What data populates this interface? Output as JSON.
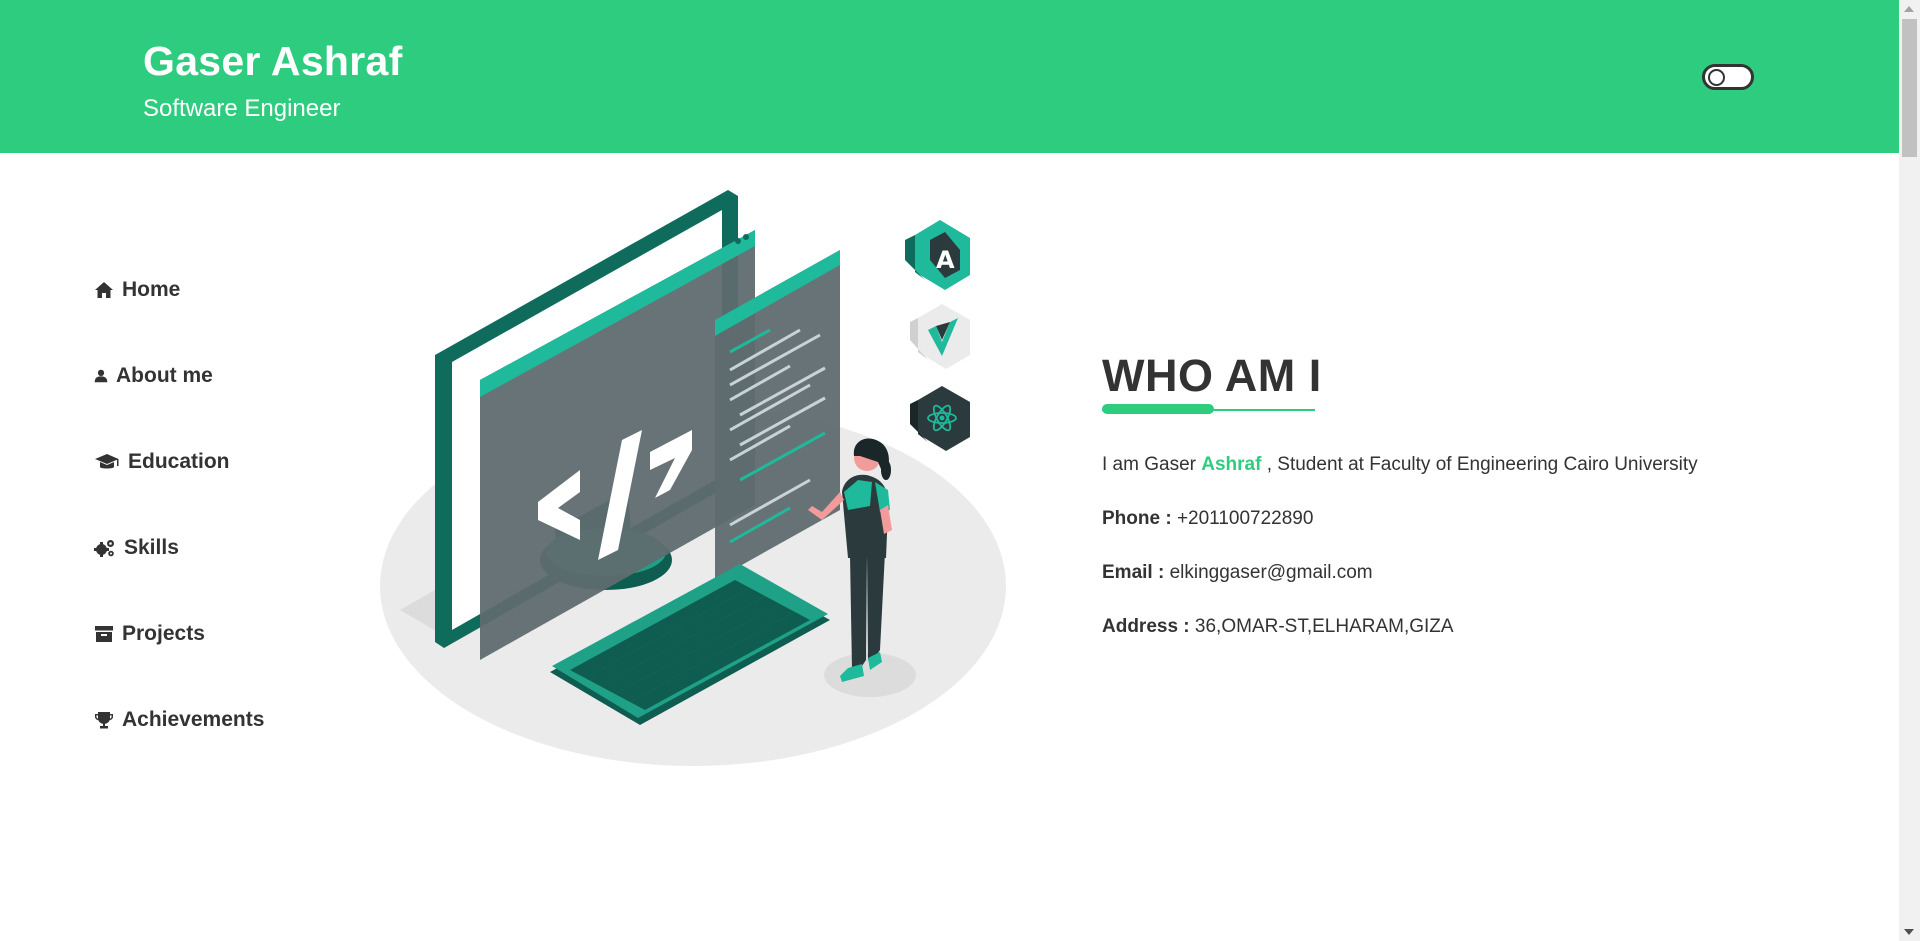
{
  "theme": {
    "accent": "#2ecc7f",
    "text": "#333333"
  },
  "header": {
    "name": "Gaser Ashraf",
    "role": "Software Engineer",
    "theme_toggle": {
      "state": "off"
    }
  },
  "sidebar": {
    "items": [
      {
        "label": "Home",
        "icon": "home-icon"
      },
      {
        "label": "About me",
        "icon": "user-icon"
      },
      {
        "label": "Education",
        "icon": "graduation-cap-icon"
      },
      {
        "label": "Skills",
        "icon": "cogs-icon"
      },
      {
        "label": "Projects",
        "icon": "archive-icon"
      },
      {
        "label": "Achievements",
        "icon": "trophy-icon"
      }
    ]
  },
  "about": {
    "heading": "WHO AM I",
    "intro_prefix": "I am Gaser",
    "intro_highlight": "Ashraf",
    "intro_suffix": ", Student at Faculty of Engineering Cairo University",
    "phone_label": "Phone :",
    "phone_value": "+201100722890",
    "email_label": "Email :",
    "email_value": "elkinggaser@gmail.com",
    "address_label": "Address :",
    "address_value": "36,OMAR-ST,ELHARAM,GIZA"
  },
  "illustration": {
    "description_icons": [
      "angular-logo-icon",
      "vue-logo-icon",
      "react-logo-icon"
    ],
    "screen_glyph": "</>"
  }
}
